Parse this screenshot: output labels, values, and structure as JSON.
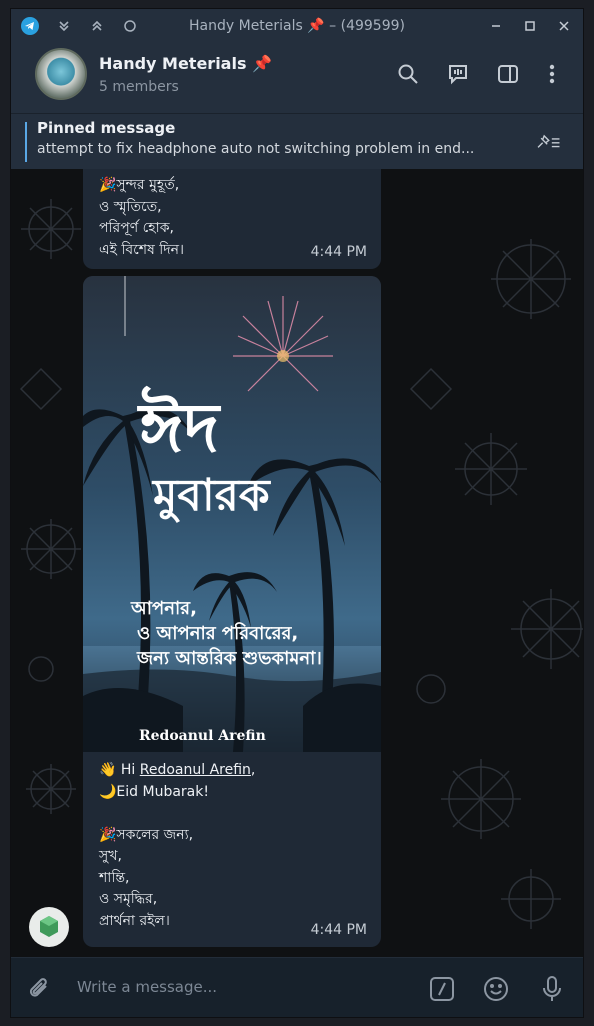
{
  "window": {
    "title": "Handy Meterials 📌 – (499599)"
  },
  "header": {
    "chat_name": "Handy Meterials 📌",
    "member_count": "5 members"
  },
  "pinned": {
    "label": "Pinned message",
    "text": "attempt to fix headphone auto not switching problem in end..."
  },
  "messages": [
    {
      "lines": [
        "🎉সুন্দর মুহূর্ত,",
        "ও স্মৃতিতে,",
        "পরিপূর্ণ হোক,",
        "এই বিশেষ দিন।"
      ],
      "time": "4:44 PM"
    },
    {
      "image": {
        "title_line1": "ঈদ",
        "title_line2": "মুবারক",
        "wish_line1": "আপনার,",
        "wish_line2": "ও আপনার পরিবারের,",
        "wish_line3": "জন্য আন্তরিক শুভকামনা।",
        "signature": "Redoanul Arefin"
      },
      "greeting_prefix": "👋 Hi ",
      "greeting_link": "Redoanul Arefin",
      "greeting_suffix": ",",
      "lines": [
        "🌙Eid Mubarak!",
        "",
        "🎉সকলের জন্য,",
        "সুখ,",
        "শান্তি,",
        "ও সমৃদ্ধির,",
        "প্রার্থনা রইল।"
      ],
      "time": "4:44 PM"
    }
  ],
  "composer": {
    "placeholder": "Write a message..."
  },
  "colors": {
    "window_bg": "#17212b",
    "header_bg": "#242f3d",
    "bubble_bg": "#1f2936",
    "accent": "#5aa8e6"
  }
}
